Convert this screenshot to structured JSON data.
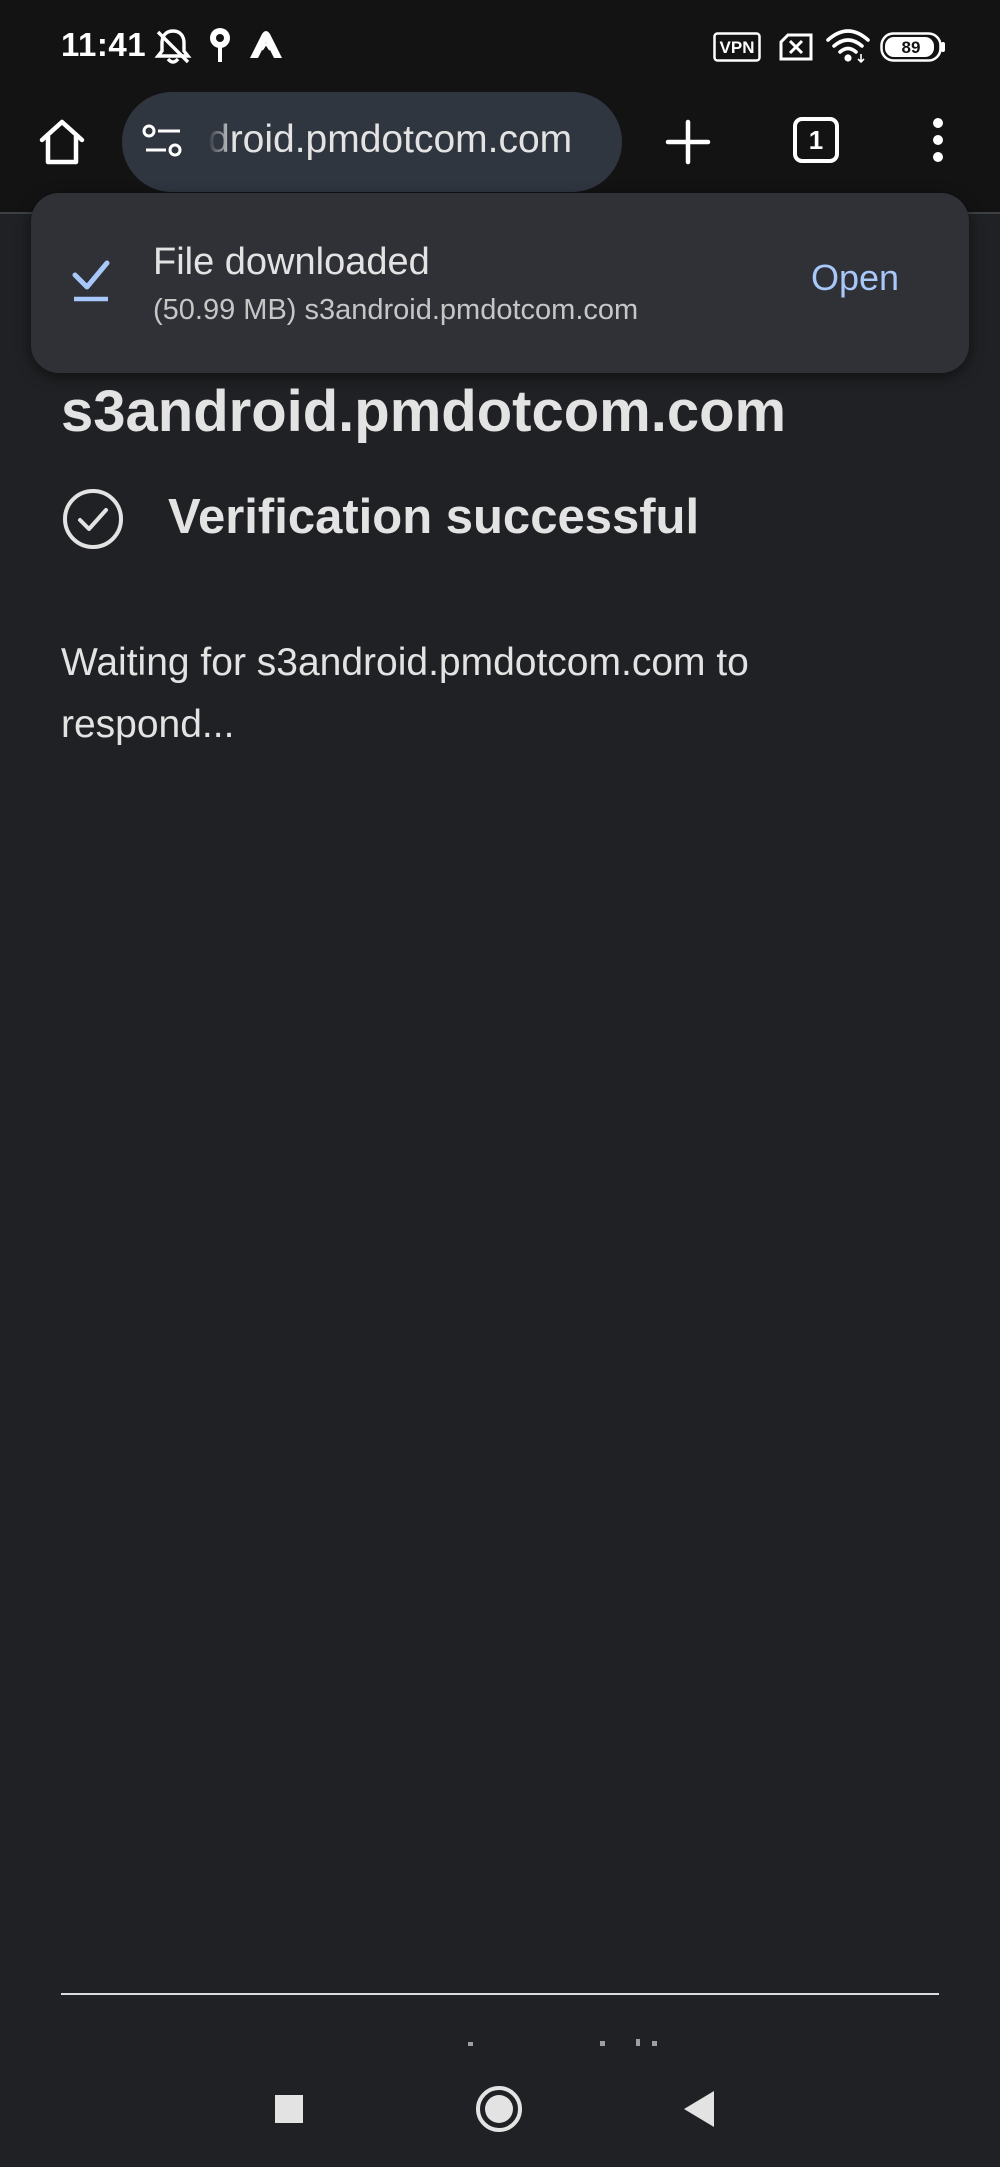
{
  "status_bar": {
    "time": "11:41",
    "left_icons": [
      "bell-off-icon",
      "location-pin-icon",
      "vpn-app-icon"
    ],
    "vpn_label": "VPN",
    "battery": "89"
  },
  "toolbar": {
    "url": "droid.pmdotcom.com",
    "tab_count": "1"
  },
  "download_toast": {
    "title": "File downloaded",
    "subtitle": "(50.99 MB) s3android.pmdotcom.com",
    "action": "Open"
  },
  "page": {
    "site_title": "s3android.pmdotcom.com",
    "verification": "Verification successful",
    "waiting": "Waiting for s3android.pmdotcom.com to respond..."
  },
  "colors": {
    "background": "#202124",
    "toolbar": "#131314",
    "omnibox": "#303640",
    "toast": "#2f3136",
    "accent_link": "#a8c7fa",
    "download_check": "#a8c7fa"
  }
}
